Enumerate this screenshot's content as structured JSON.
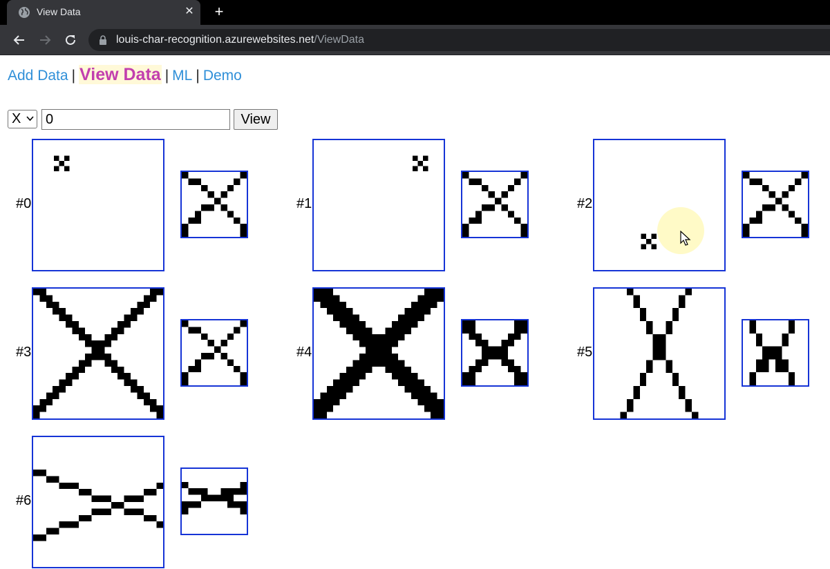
{
  "browser": {
    "tab_title": "View Data",
    "tab_close": "✕",
    "new_tab": "+",
    "url_host": "louis-char-recognition.azurewebsites.net",
    "url_path": "/ViewData"
  },
  "nav": {
    "add_data": "Add Data",
    "view_data": "View Data",
    "ml": "ML",
    "demo": "Demo",
    "separator": "|"
  },
  "controls": {
    "selected_char": "X",
    "index_value": "0",
    "view_button": "View"
  },
  "samples": [
    {
      "label": "#0",
      "grid": 8,
      "big": [
        [
          0,
          0
        ],
        [
          0,
          2
        ],
        [
          1,
          1
        ],
        [
          2,
          0
        ],
        [
          2,
          2
        ]
      ],
      "big_offset": [
        4,
        3
      ],
      "big_size": 25
    },
    {
      "label": "#1",
      "grid": 8,
      "big": [
        [
          0,
          0
        ],
        [
          0,
          2
        ],
        [
          1,
          1
        ],
        [
          2,
          0
        ],
        [
          2,
          2
        ]
      ],
      "big_offset": [
        19,
        3
      ],
      "big_size": 25
    },
    {
      "label": "#2",
      "grid": 8,
      "big": [
        [
          0,
          0
        ],
        [
          0,
          2
        ],
        [
          1,
          1
        ],
        [
          2,
          0
        ],
        [
          2,
          2
        ]
      ],
      "big_offset": [
        9,
        18
      ],
      "big_size": 25
    },
    {
      "label": "#3"
    },
    {
      "label": "#4"
    },
    {
      "label": "#5"
    },
    {
      "label": "#6"
    }
  ],
  "icons": {
    "tab": "globe-icon",
    "back": "arrow-left-icon",
    "forward": "arrow-right-icon",
    "reload": "reload-icon",
    "lock": "lock-icon",
    "dropdown": "chevron-down-icon",
    "cursor": "mouse-pointer-icon"
  },
  "colors": {
    "link": "#2f8fd8",
    "current_link": "#c23fae",
    "frame_border": "#1533d6"
  }
}
